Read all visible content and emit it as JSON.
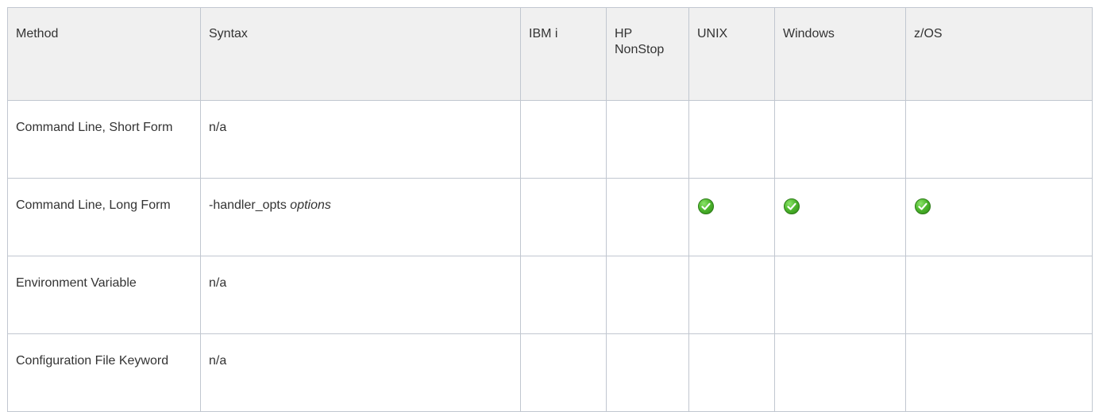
{
  "table": {
    "headers": {
      "method": "Method",
      "syntax": "Syntax",
      "ibmi": "IBM i",
      "hp_nonstop_line1": "HP",
      "hp_nonstop_line2": "NonStop",
      "unix": "UNIX",
      "windows": "Windows",
      "zos": "z/OS"
    },
    "rows": [
      {
        "method": "Command Line, Short Form",
        "syntax": "n/a",
        "ibmi": false,
        "hp_nonstop": false,
        "unix": false,
        "windows": false,
        "zos": false
      },
      {
        "method": "Command Line, Long Form",
        "syntax_prefix": "-handler_opts ",
        "syntax_italic": "options",
        "ibmi": false,
        "hp_nonstop": false,
        "unix": true,
        "windows": true,
        "zos": true
      },
      {
        "method": "Environment Variable",
        "syntax": "n/a",
        "ibmi": false,
        "hp_nonstop": false,
        "unix": false,
        "windows": false,
        "zos": false
      },
      {
        "method": "Configuration File Keyword",
        "syntax": "n/a",
        "ibmi": false,
        "hp_nonstop": false,
        "unix": false,
        "windows": false,
        "zos": false
      }
    ]
  },
  "icons": {
    "supported": "check-circle-icon"
  },
  "colors": {
    "header_bg": "#f0f0f0",
    "border": "#c1c7d0",
    "check_green": "#4fb82e",
    "text": "#333333"
  }
}
